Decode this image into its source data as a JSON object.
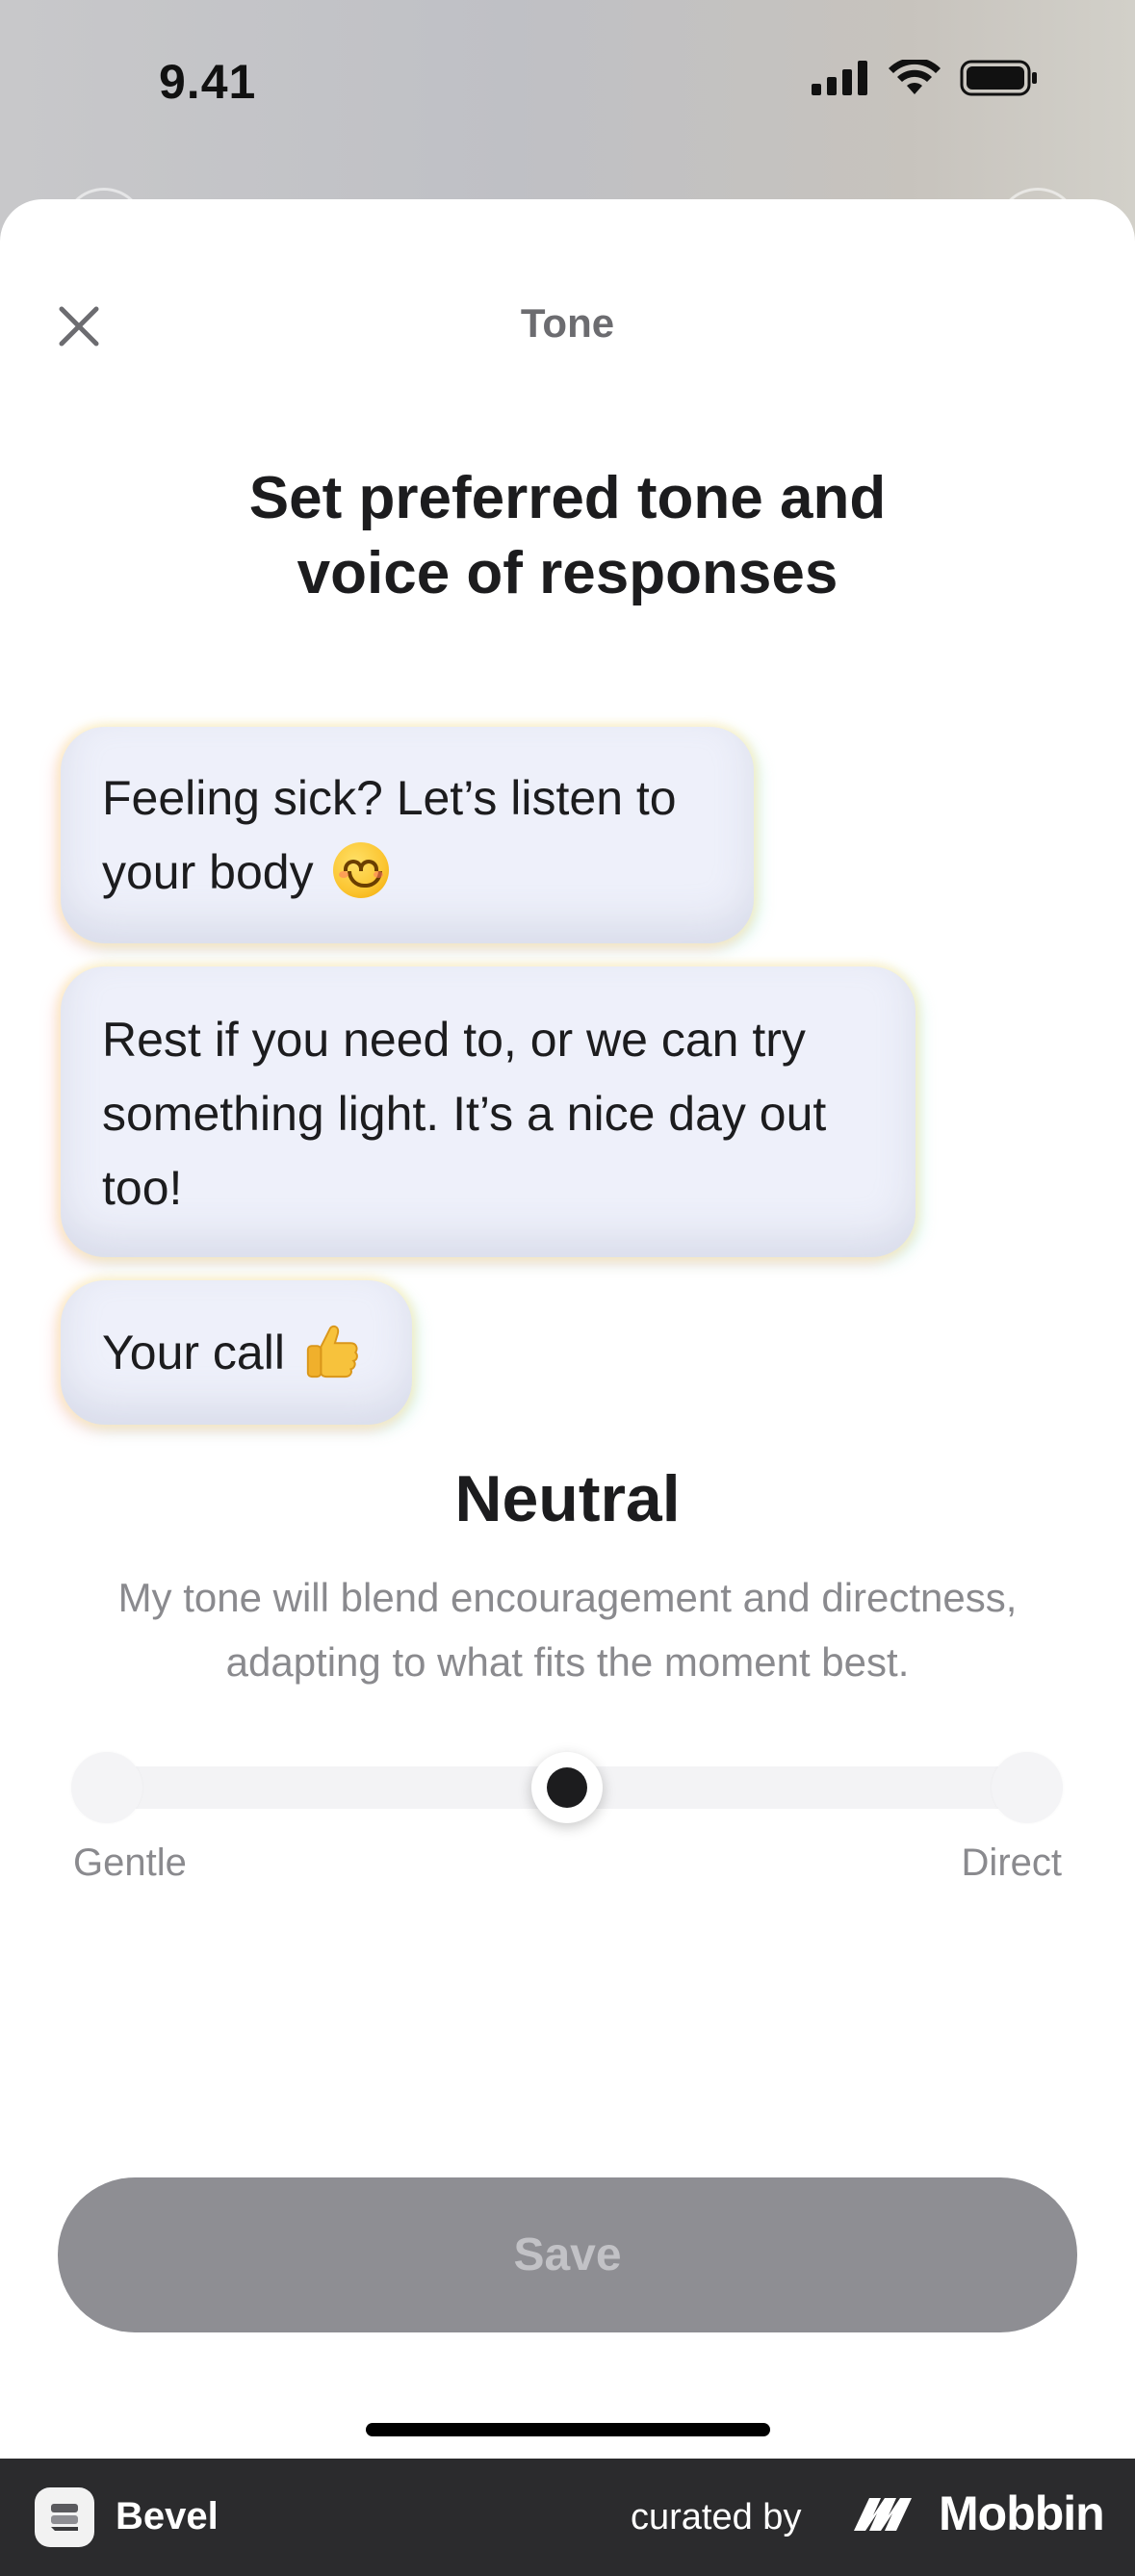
{
  "status_bar": {
    "time": "9.41",
    "icons": [
      "cellular-signal-icon",
      "wifi-icon",
      "battery-icon"
    ]
  },
  "sheet": {
    "title": "Tone",
    "headline_line1": "Set preferred tone and",
    "headline_line2": "voice of responses"
  },
  "bubbles": [
    {
      "line1": "Feeling sick? Let’s listen to",
      "line2": "your body",
      "emoji": "smiling-face-icon"
    },
    {
      "line1": "Rest if you need to, or we can try",
      "line2": "something light. It’s a nice day out",
      "line3": "too!"
    },
    {
      "line1": "Your call",
      "emoji": "thumbs-up-icon"
    }
  ],
  "tone": {
    "name": "Neutral",
    "description": "My tone will blend encouragement and directness, adapting to what fits the moment best.",
    "slider": {
      "min_label": "Gentle",
      "max_label": "Direct",
      "value": 0.5
    }
  },
  "save_label": "Save",
  "colors": {
    "bubble_bg": "#eef0fa",
    "save_bg": "#8e8e93",
    "text_dark": "#1c1c1e",
    "text_muted": "#8a8a8e"
  },
  "footer": {
    "app_name": "Bevel",
    "curated_by": "curated by",
    "brand": "Mobbin"
  }
}
